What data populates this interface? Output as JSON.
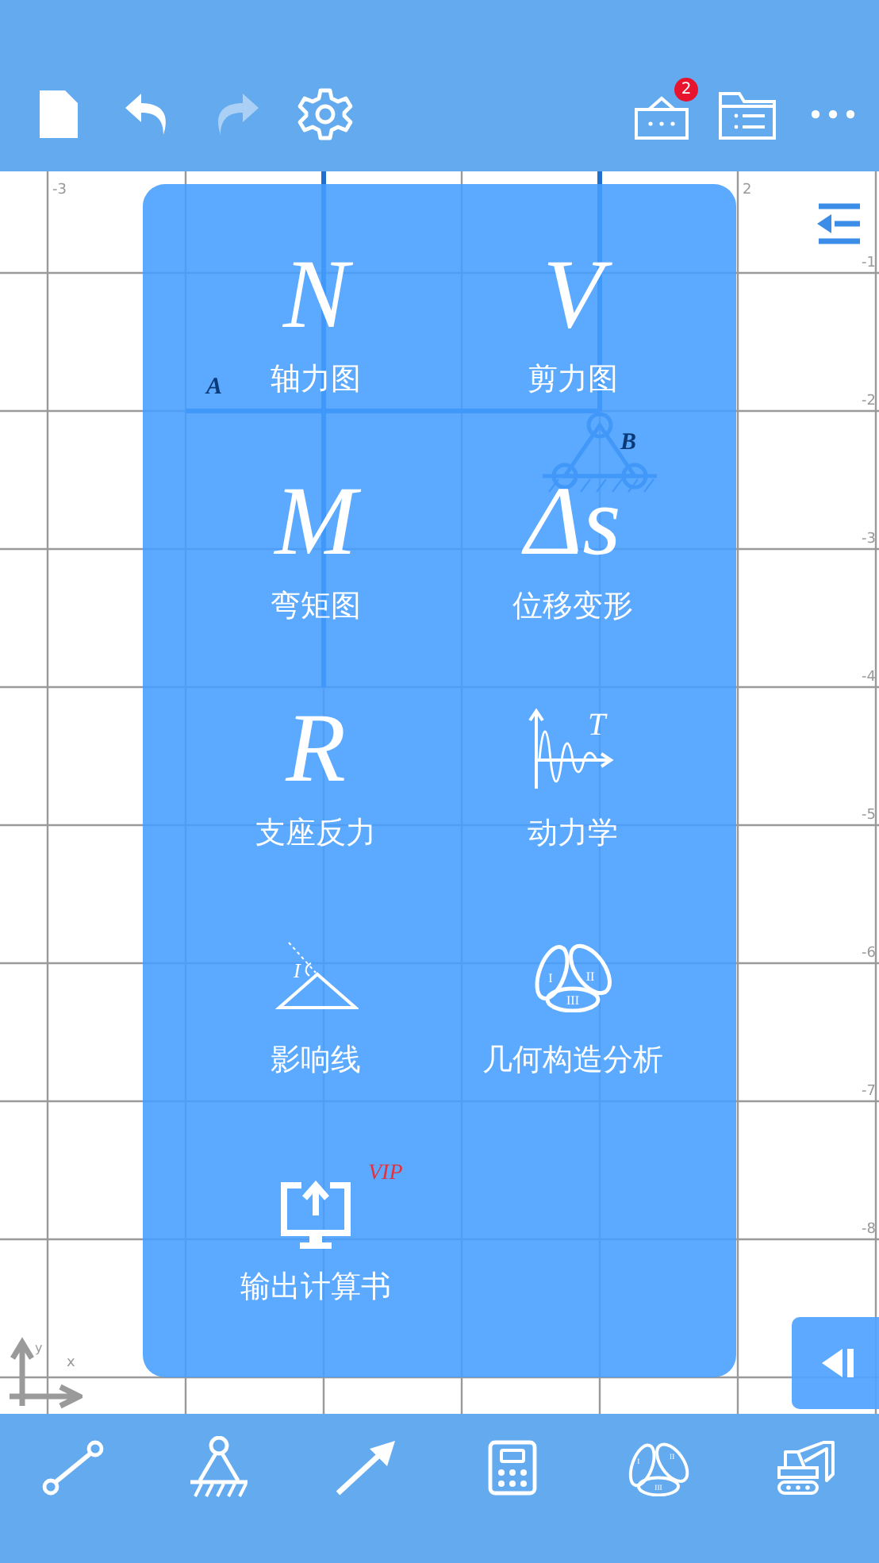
{
  "toolbar": {
    "left": [
      {
        "kind": "new-file",
        "disabled": false
      },
      {
        "kind": "undo",
        "disabled": false
      },
      {
        "kind": "redo",
        "disabled": true
      },
      {
        "kind": "settings",
        "disabled": false
      }
    ],
    "right": [
      {
        "kind": "inbox",
        "badge": "2"
      },
      {
        "kind": "file-list"
      },
      {
        "kind": "more"
      }
    ]
  },
  "canvas": {
    "x_labels": [
      "-3",
      "2"
    ],
    "y_labels": [
      "-1",
      "-2",
      "-3",
      "-4",
      "-5",
      "-6",
      "-7",
      "-8"
    ],
    "structure_labels": [
      "A",
      "B"
    ],
    "axes": {
      "y": "y",
      "x": "x"
    }
  },
  "menu": [
    {
      "kind": "letter",
      "symbol": "N",
      "label": "轴力图"
    },
    {
      "kind": "letter",
      "symbol": "V",
      "label": "剪力图"
    },
    {
      "kind": "letter",
      "symbol": "M",
      "label": "弯矩图"
    },
    {
      "kind": "letter",
      "symbol": "Δs",
      "label": "位移变形"
    },
    {
      "kind": "letter",
      "symbol": "R",
      "label": "支座反力"
    },
    {
      "kind": "dynamics",
      "icon_texts": [
        "T"
      ],
      "label": "动力学"
    },
    {
      "kind": "influence",
      "icon_texts": [
        "I"
      ],
      "label": "影响线"
    },
    {
      "kind": "geometry",
      "icon_texts": [
        "I",
        "II",
        "III"
      ],
      "label": "几何构造分析"
    },
    {
      "kind": "export",
      "badge": "VIP",
      "label": "输出计算书"
    }
  ],
  "bottom_toolbar": [
    {
      "kind": "member"
    },
    {
      "kind": "support"
    },
    {
      "kind": "load"
    },
    {
      "kind": "calculator"
    },
    {
      "kind": "geometry",
      "icon_texts": [
        "I",
        "II",
        "III"
      ]
    },
    {
      "kind": "excavator"
    }
  ]
}
